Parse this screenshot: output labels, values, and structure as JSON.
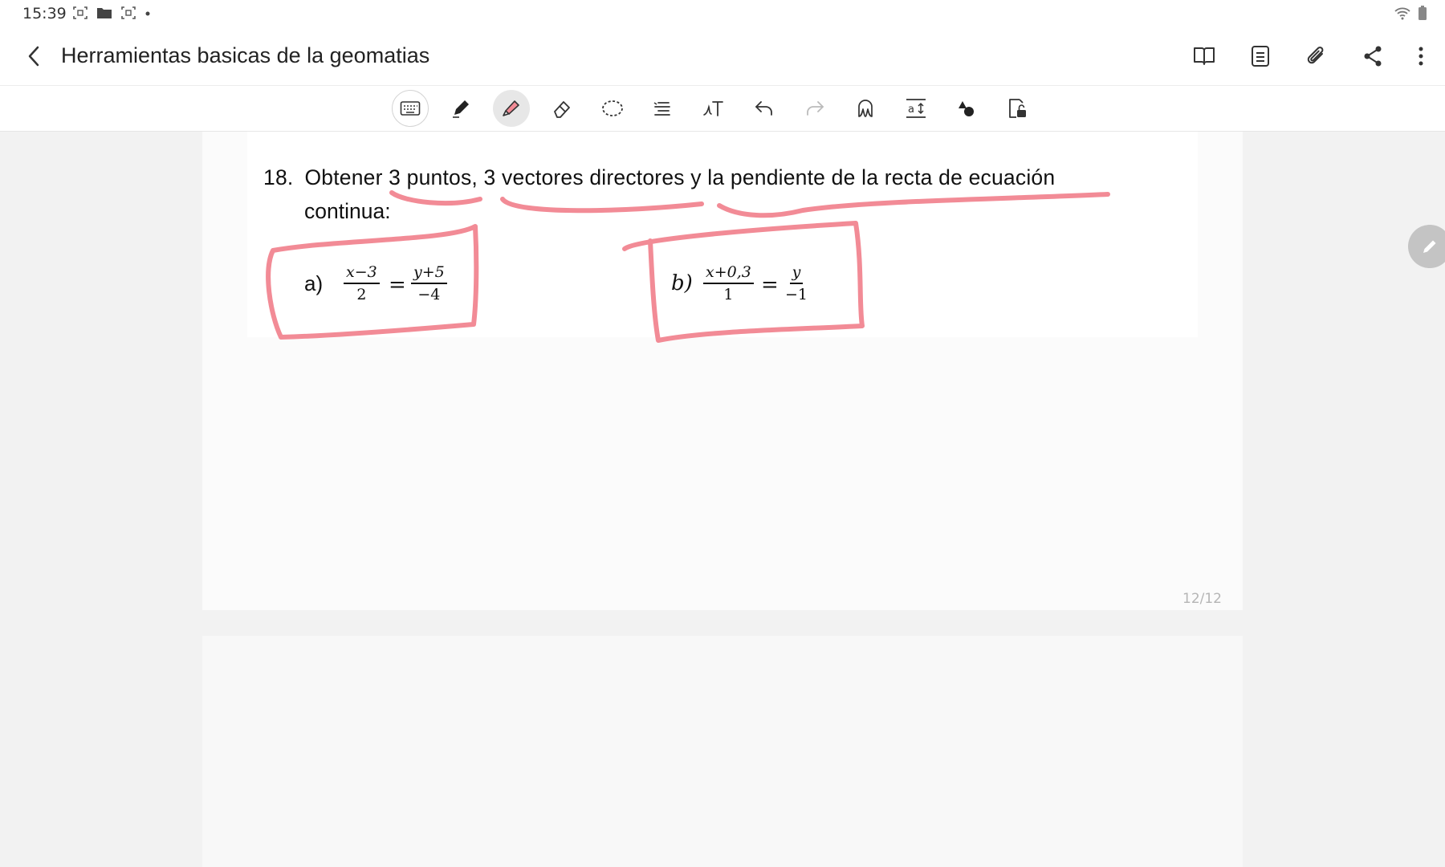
{
  "status": {
    "time": "15:39"
  },
  "header": {
    "title": "Herramientas basicas de la geomatias"
  },
  "document": {
    "problem": {
      "number": "18.",
      "text_line1": "Obtener 3 puntos, 3 vectores directores y la pendiente de la recta de ecuación",
      "text_line2": "continua:",
      "items": [
        {
          "label": "a)",
          "lhs_num": "x−3",
          "lhs_den": "2",
          "rhs_num": "y+5",
          "rhs_den": "−4",
          "eq": "="
        },
        {
          "label": "b)",
          "lhs_num": "x+0,3",
          "lhs_den": "1",
          "rhs_num": "y",
          "rhs_den": "−1",
          "eq": "="
        }
      ]
    },
    "page_indicator": "12/12"
  },
  "colors": {
    "ink": "#f28b96",
    "accent": "#222222"
  }
}
